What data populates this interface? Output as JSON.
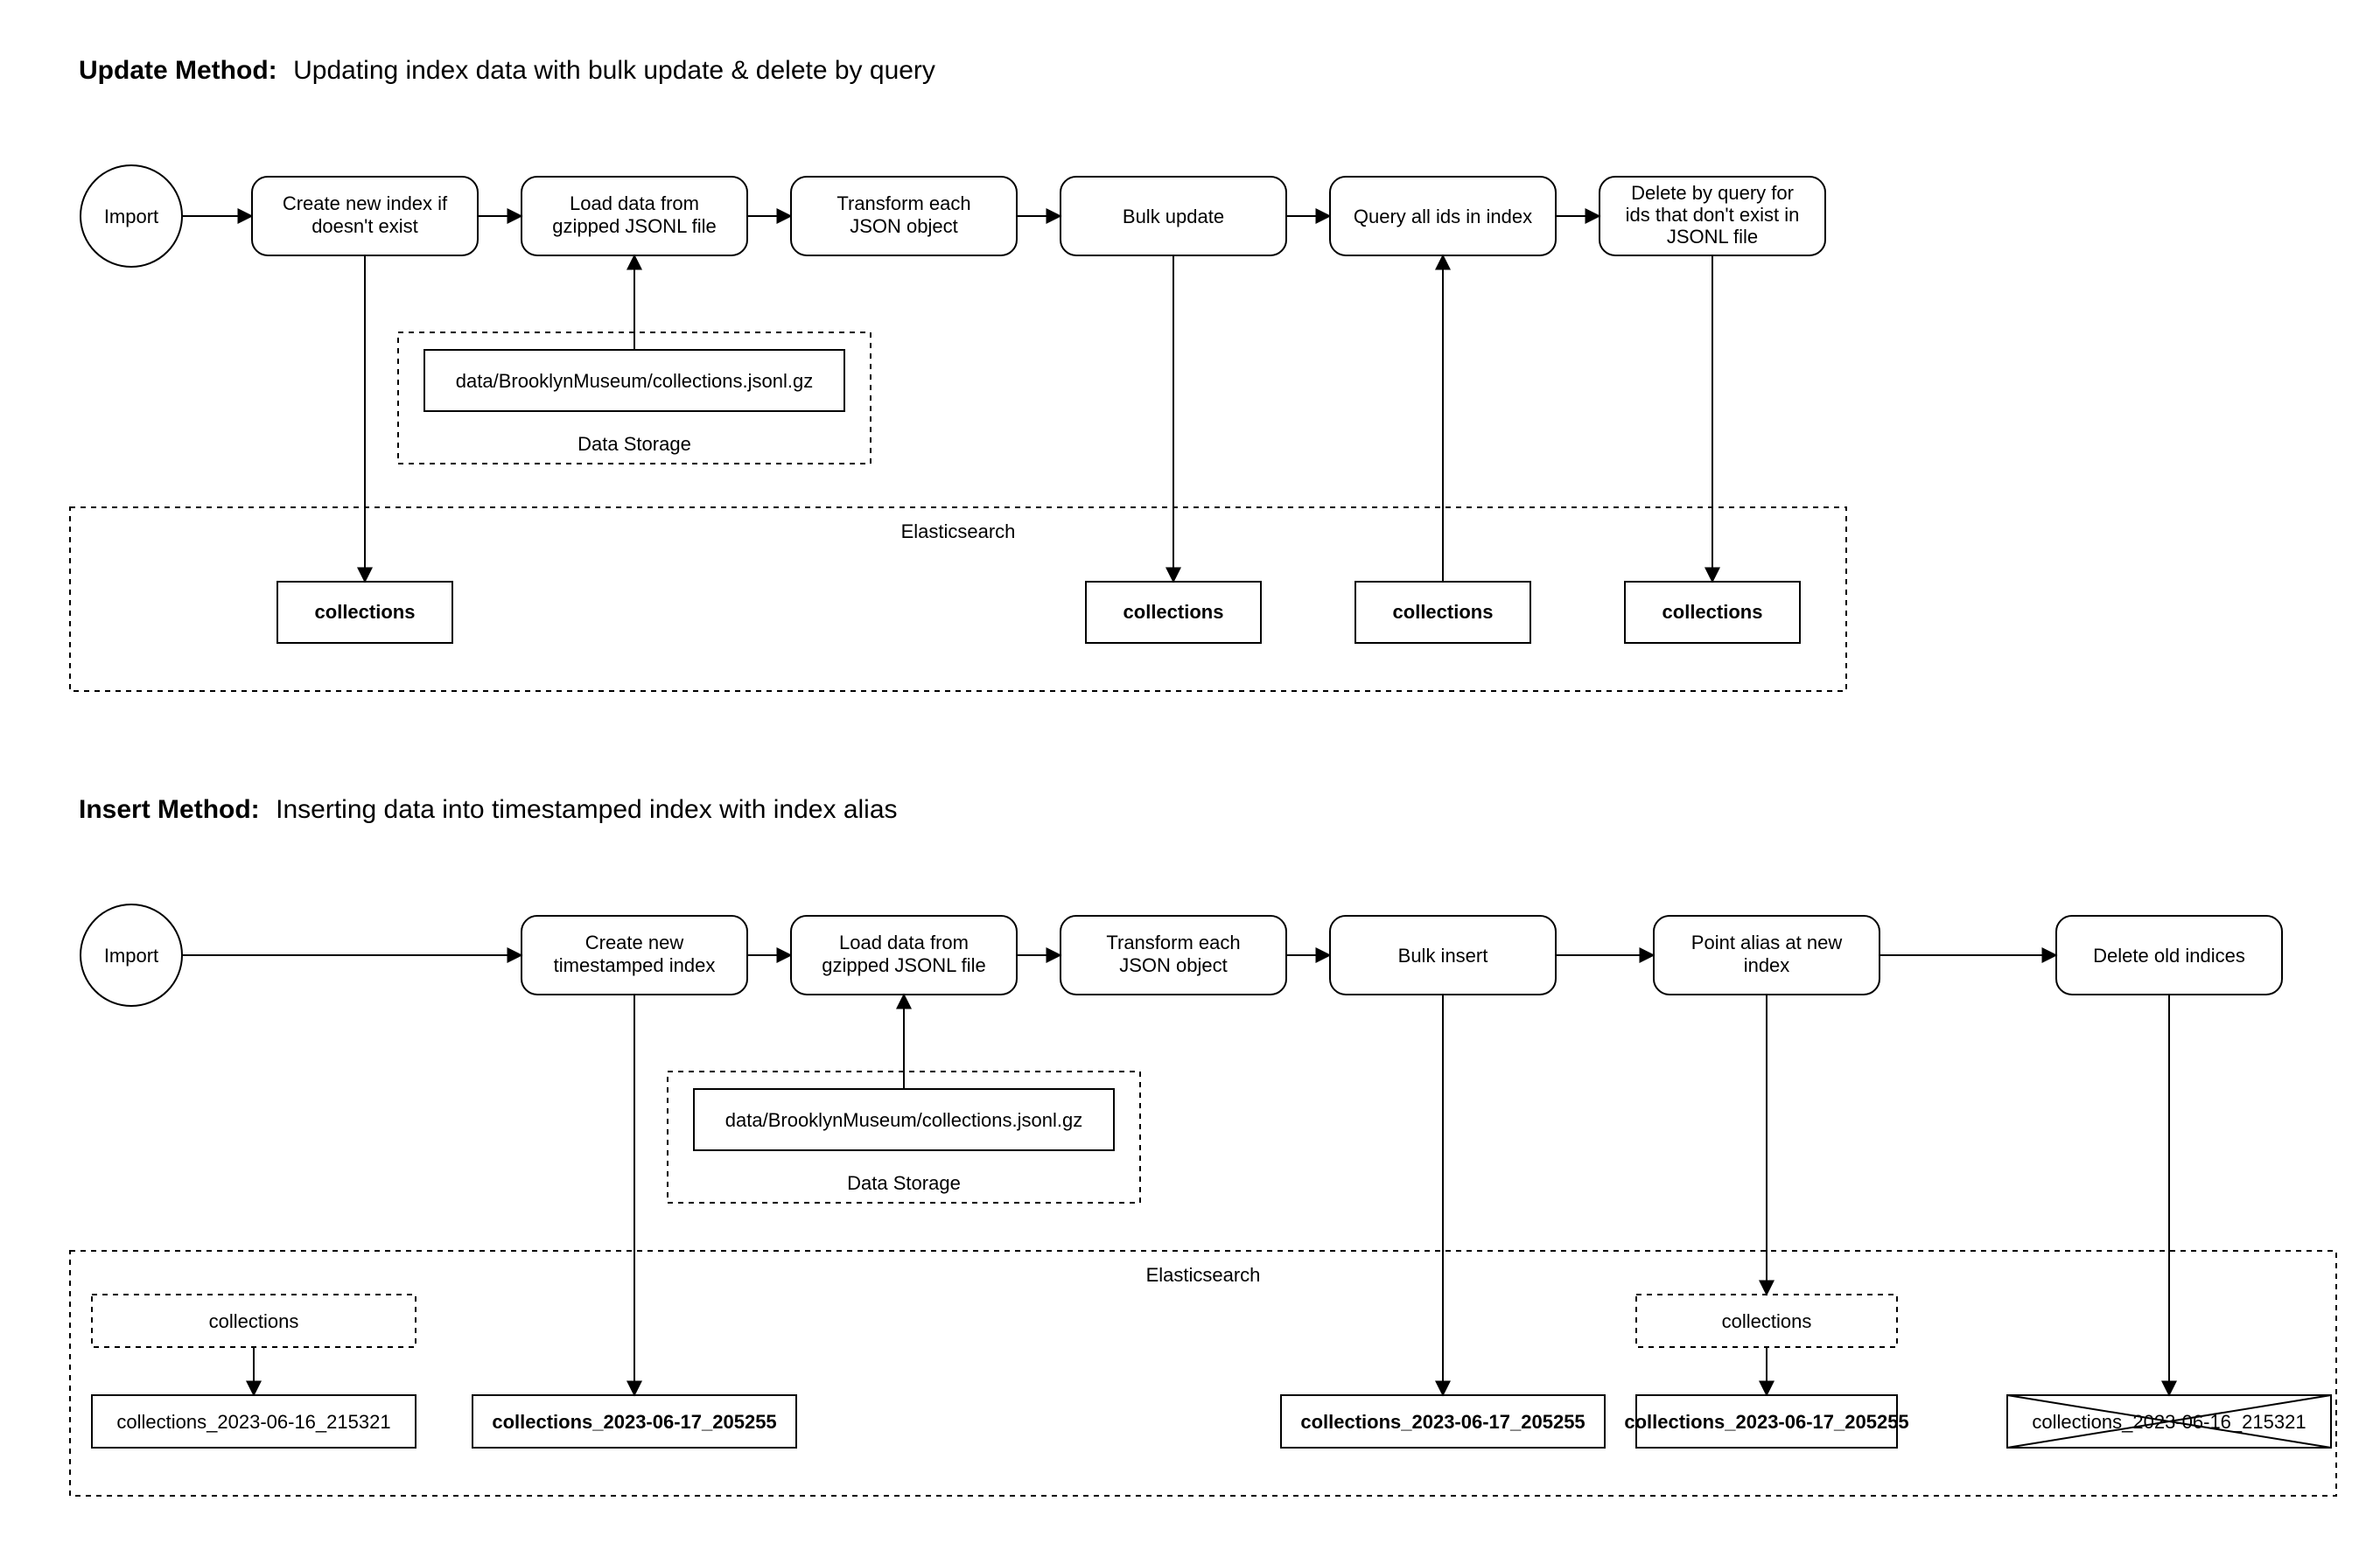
{
  "titles": {
    "update_strong": "Update Method:",
    "update_rest": "Updating index data with bulk update & delete by query",
    "insert_strong": "Insert Method:",
    "insert_rest": "Inserting data into timestamped index with index alias"
  },
  "common": {
    "import": "Import",
    "data_storage": "Data Storage",
    "elasticsearch": "Elasticsearch",
    "data_file": "data/BrooklynMuseum/collections.jsonl.gz",
    "collections": "collections",
    "load_l1": "Load data from",
    "load_l2": "gzipped JSONL file",
    "transform_l1": "Transform each",
    "transform_l2": "JSON object"
  },
  "update": {
    "create_l1": "Create new index if",
    "create_l2": "doesn't exist",
    "bulk": "Bulk update",
    "query_ids": "Query all ids in index",
    "delete_l1": "Delete by query for",
    "delete_l2": "ids that don't exist in",
    "delete_l3": "JSONL file"
  },
  "insert": {
    "create_l1": "Create new",
    "create_l2": "timestamped index",
    "bulk": "Bulk insert",
    "alias_l1": "Point alias at new",
    "alias_l2": "index",
    "delete_old": "Delete old indices",
    "idx_old": "collections_2023-06-16_215321",
    "idx_new": "collections_2023-06-17_205255"
  }
}
